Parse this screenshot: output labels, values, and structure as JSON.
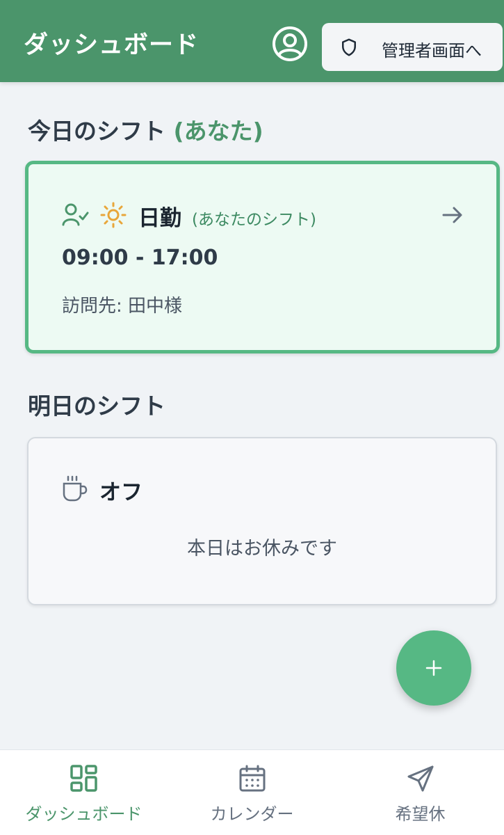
{
  "header": {
    "title": "ダッシュボード",
    "account_icon": "user-circle-icon",
    "admin_button": {
      "icon": "shield-icon",
      "label": "管理者画面へ"
    }
  },
  "today": {
    "title": "今日のシフト",
    "title_accent": "(あなた)",
    "card": {
      "icons": [
        "user-check-icon",
        "sun-icon",
        "arrow-right-icon"
      ],
      "shift_name": "日勤",
      "shift_owner": "(あなたのシフト)",
      "time": "09:00 - 17:00",
      "visit": "訪問先: 田中様"
    }
  },
  "tomorrow": {
    "title": "明日のシフト",
    "card": {
      "icon": "coffee-icon",
      "label": "オフ",
      "message": "本日はお休みです"
    }
  },
  "fab": {
    "icon": "plus-icon"
  },
  "bottom_nav": {
    "items": [
      {
        "label": "ダッシュボード",
        "icon": "dashboard-grid-icon",
        "active": true
      },
      {
        "label": "カレンダー",
        "icon": "calendar-icon",
        "active": false
      },
      {
        "label": "希望休",
        "icon": "send-icon",
        "active": false
      }
    ]
  },
  "colors": {
    "primary": "#4b956b",
    "accent_green": "#56b884",
    "today_card_bg": "#edfaf3",
    "page_bg": "#f0f3f6",
    "sun": "#e8a63a"
  }
}
